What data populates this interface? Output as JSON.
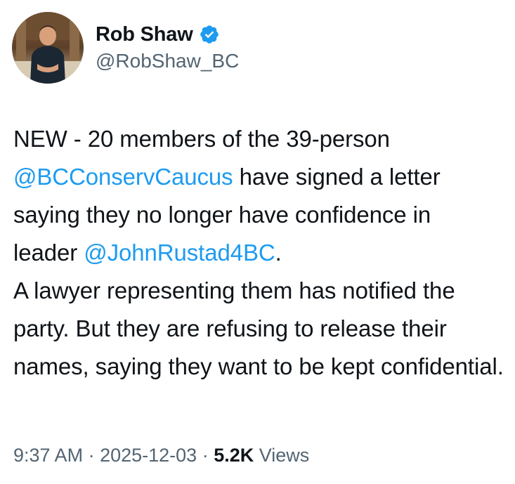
{
  "author": {
    "display_name": "Rob Shaw",
    "handle": "@RobShaw_BC",
    "verified": true,
    "avatar_icon": "profile-photo"
  },
  "tweet": {
    "line1": "NEW - 20 members of the 39-person",
    "mention1": "@BCConservCaucus",
    "line2_rest": " have signed a letter",
    "line3": "saying they no longer have confidence in",
    "line4_prefix": "leader ",
    "mention2": "@JohnRustad4BC",
    "line4_suffix": ".",
    "line5": "A lawyer representing them has notified the party. But they are refusing to release their names, saying they want to be kept confidential."
  },
  "meta": {
    "time": "9:37 AM",
    "separator1": " · ",
    "date": "2025-12-03",
    "separator2": " · ",
    "views_count": "5.2K",
    "views_label": " Views"
  },
  "colors": {
    "text": "#0f1419",
    "secondary": "#536471",
    "link": "#1d9bf0",
    "verified": "#1d9bf0"
  }
}
